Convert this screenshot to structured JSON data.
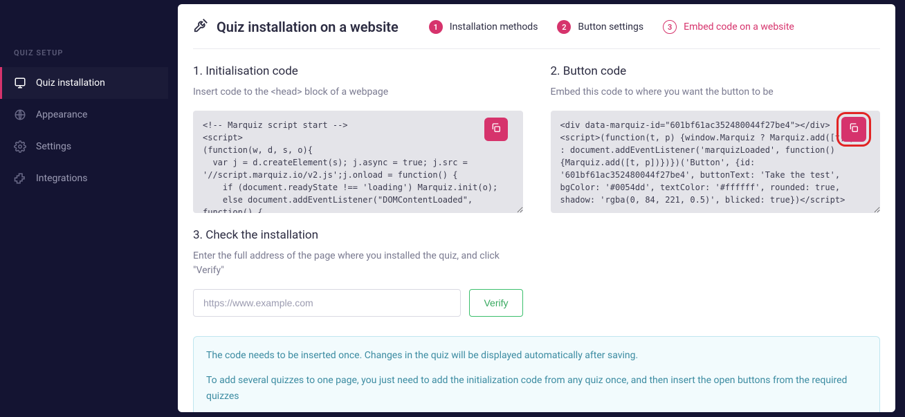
{
  "sidebar": {
    "heading": "QUIZ SETUP",
    "items": [
      {
        "label": "Quiz installation"
      },
      {
        "label": "Appearance"
      },
      {
        "label": "Settings"
      },
      {
        "label": "Integrations"
      }
    ]
  },
  "header": {
    "title": "Quiz installation on a website",
    "steps": [
      {
        "num": "1",
        "label": "Installation methods"
      },
      {
        "num": "2",
        "label": "Button settings"
      },
      {
        "num": "3",
        "label": "Embed code on a website"
      }
    ]
  },
  "section1": {
    "title": "1. Initialisation code",
    "desc": "Insert code to the <head> block of a webpage",
    "code": "<!-- Marquiz script start -->\n<script>\n(function(w, d, s, o){\n  var j = d.createElement(s); j.async = true; j.src = '//script.marquiz.io/v2.js';j.onload = function() {\n    if (document.readyState !== 'loading') Marquiz.init(o);\n    else document.addEventListener(\"DOMContentLoaded\", function() {\n      Marquiz.init(o);"
  },
  "section2": {
    "title": "2. Button code",
    "desc": "Embed this code to where you want the button to be",
    "code": "<div data-marquiz-id=\"601bf61ac352480044f27be4\"></div>\n<script>(function(t, p) {window.Marquiz ? Marquiz.add([t, p]) : document.addEventListener('marquizLoaded', function() {Marquiz.add([t, p])})})('Button', {id: '601bf61ac352480044f27be4', buttonText: 'Take the test', bgColor: '#0054dd', textColor: '#ffffff', rounded: true, shadow: 'rgba(0, 84, 221, 0.5)', blicked: true})</​script>"
  },
  "section3": {
    "title": "3. Check the installation",
    "desc": "Enter the full address of the page where you installed the quiz, and click \"Verify\"",
    "placeholder": "https://www.example.com",
    "verify_label": "Verify"
  },
  "info": {
    "line1": "The code needs to be inserted once. Changes in the quiz will be displayed automatically after saving.",
    "line2": "To add several quizzes to one page, you just need to add the initialization code from any quiz once, and then insert the open buttons from the required quizzes"
  }
}
